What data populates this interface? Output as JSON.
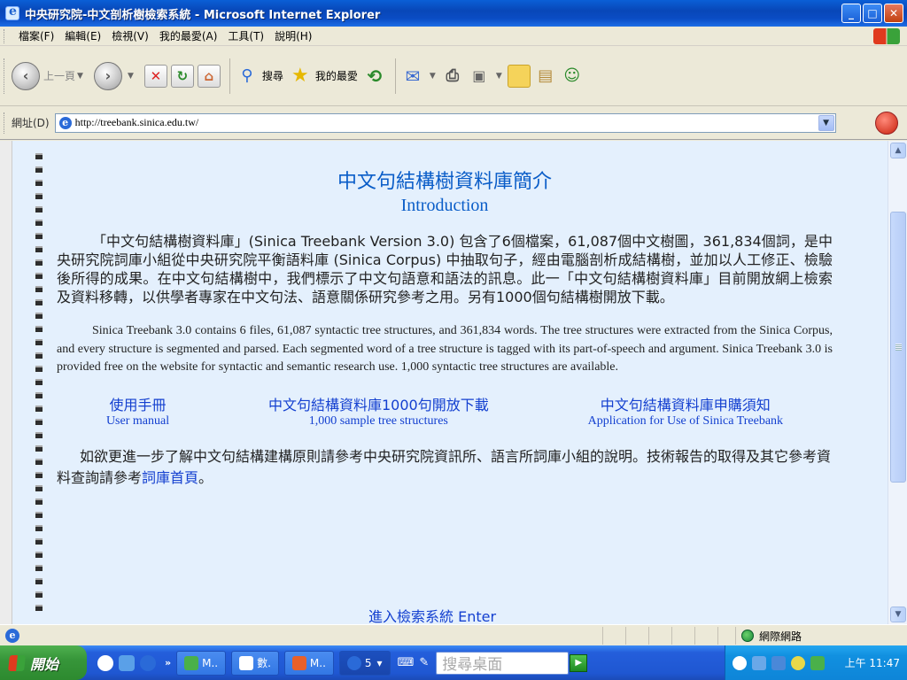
{
  "window": {
    "title": "中央研究院-中文剖析樹檢索系統 - Microsoft Internet Explorer",
    "buttons": {
      "minimize": "_",
      "maximize": "□",
      "close": "✕"
    }
  },
  "menu": [
    "檔案(F)",
    "編輯(E)",
    "檢視(V)",
    "我的最愛(A)",
    "工具(T)",
    "說明(H)"
  ],
  "toolbar": {
    "back_label": "上一頁",
    "search_label": "搜尋",
    "favorites_label": "我的最愛"
  },
  "address": {
    "label": "網址(D)",
    "url": "http://treebank.sinica.edu.tw/"
  },
  "page": {
    "title_zh": "中文句結構樹資料庫簡介",
    "title_en": "Introduction",
    "para_zh": "「中文句結構樹資料庫」(Sinica Treebank Version 3.0) 包含了6個檔案，61,087個中文樹圖，361,834個詞，是中央研究院詞庫小組從中央研究院平衡語料庫 (Sinica Corpus) 中抽取句子，經由電腦剖析成結構樹，並加以人工修正、檢驗後所得的成果。在中文句結構樹中，我們標示了中文句語意和語法的訊息。此一「中文句結構樹資料庫」目前開放網上檢索及資料移轉，以供學者專家在中文句法、語意關係研究參考之用。另有1000個句結構樹開放下載。",
    "para_en": "Sinica Treebank 3.0 contains 6 files, 61,087 syntactic tree structures, and 361,834 words. The tree structures were extracted from the Sinica Corpus, and every structure is segmented and parsed. Each segmented word of a tree structure is tagged with its part-of-speech and argument. Sinica Treebank 3.0 is provided free on the website for syntactic and semantic research use. 1,000 syntactic tree structures are available.",
    "links": [
      {
        "zh": "使用手冊",
        "en": "User manual"
      },
      {
        "zh": "中文句結構資料庫1000句開放下載",
        "en": "1,000 sample tree structures"
      },
      {
        "zh": "中文句結構資料庫申購須知",
        "en": "Application for Use of Sinica Treebank"
      }
    ],
    "more_text": "如欲更進一步了解中文句結構建構原則請參考中央研究院資訊所、語言所詞庫小組的說明。技術報告的取得及其它參考資料查詢請參考",
    "more_link": "詞庫首頁",
    "more_end": "。",
    "enter_text": "進入檢索系統 Enter"
  },
  "status": {
    "zone": "網際網路"
  },
  "taskbar": {
    "start": "開始",
    "tasks": [
      "M..",
      "數.",
      "M..",
      "5"
    ],
    "search_placeholder": "搜尋桌面",
    "clock": "上午 11:47"
  },
  "colors": {
    "page_bg": "#e4f0fd",
    "heading": "#0a5dc8",
    "link": "#1440d0"
  }
}
